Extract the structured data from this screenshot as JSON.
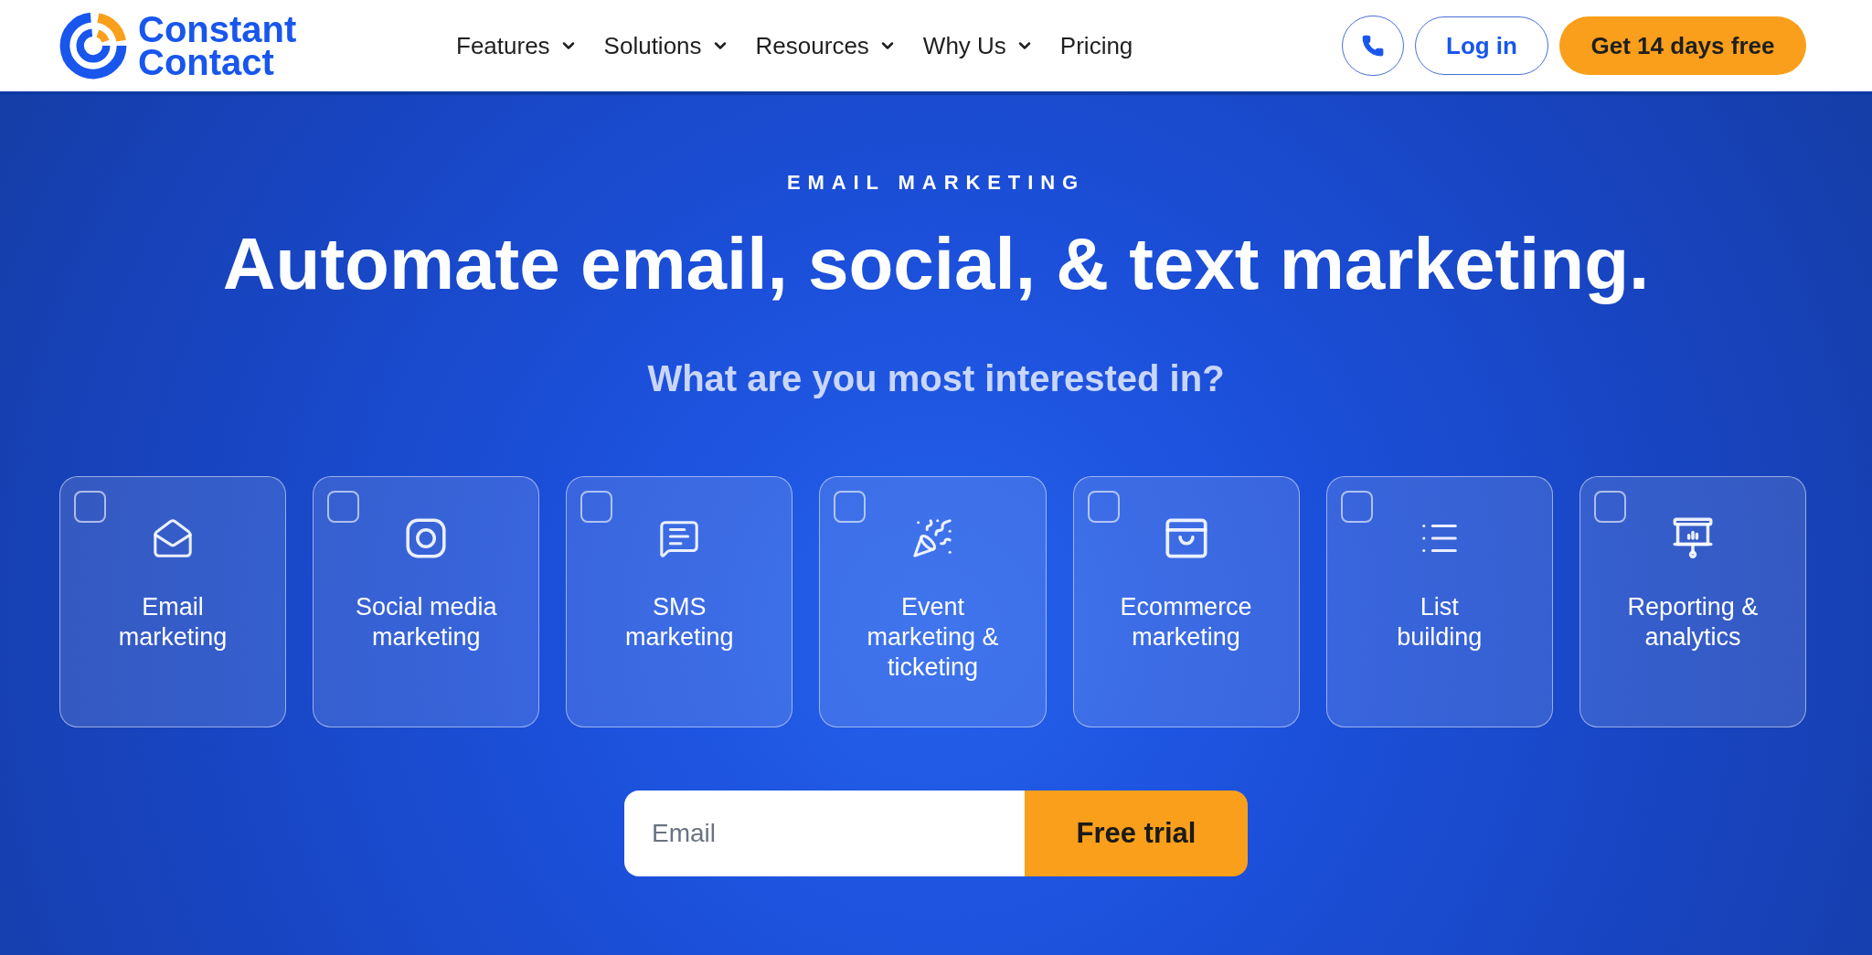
{
  "header": {
    "logo": {
      "text": "Constant Contact"
    },
    "nav": [
      {
        "label": "Features",
        "kind": "menu"
      },
      {
        "label": "Solutions",
        "kind": "menu"
      },
      {
        "label": "Resources",
        "kind": "menu"
      },
      {
        "label": "Why Us",
        "kind": "menu"
      },
      {
        "label": "Pricing",
        "kind": "link"
      }
    ],
    "actions": [
      {
        "kind": "call"
      },
      {
        "kind": "outline",
        "label": "Log in"
      },
      {
        "kind": "primary",
        "label": "Get 14 days free"
      }
    ]
  },
  "hero": {
    "eyebrow": "EMAIL MARKETING",
    "title": "Automate email, social, & text marketing.",
    "question": "What are you most interested in?",
    "options": [
      {
        "label": "Email\nmarketing",
        "checked": false
      },
      {
        "label": "Social media\nmarketing",
        "checked": false
      },
      {
        "label": "SMS\nmarketing",
        "checked": false
      },
      {
        "label": "Event\nmarketing &\nticketing",
        "checked": false
      },
      {
        "label": "Ecommerce\nmarketing",
        "checked": false
      },
      {
        "label": "List\nbuilding",
        "checked": false
      },
      {
        "label": "Reporting &\nanalytics",
        "checked": false
      }
    ],
    "signup": {
      "placeholder": "Email",
      "button": "Free trial"
    }
  }
}
